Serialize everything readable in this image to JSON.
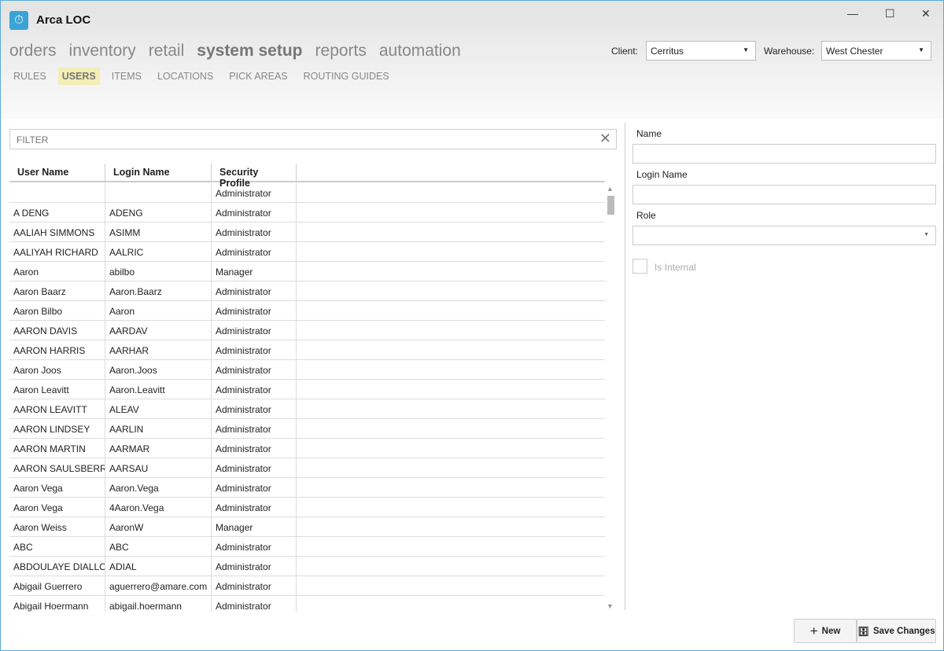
{
  "app": {
    "title": "Arca LOC"
  },
  "nav": {
    "items": [
      "orders",
      "inventory",
      "retail",
      "system setup",
      "reports",
      "automation"
    ],
    "active": 3
  },
  "subnav": {
    "items": [
      "RULES",
      "USERS",
      "ITEMS",
      "LOCATIONS",
      "PICK AREAS",
      "ROUTING GUIDES"
    ],
    "active": 1
  },
  "client": {
    "label": "Client:",
    "value": "Cerritus"
  },
  "warehouse": {
    "label": "Warehouse:",
    "value": "West Chester"
  },
  "filter": {
    "placeholder": "FILTER"
  },
  "table": {
    "columns": [
      "User Name",
      "Login Name",
      "Security Profile"
    ],
    "rows": [
      [
        "",
        "",
        "Administrator"
      ],
      [
        "A DENG",
        "ADENG",
        "Administrator"
      ],
      [
        "AALIAH SIMMONS",
        "ASIMM",
        "Administrator"
      ],
      [
        "AALIYAH RICHARD",
        "AALRIC",
        "Administrator"
      ],
      [
        "Aaron",
        "abilbo",
        "Manager"
      ],
      [
        "Aaron Baarz",
        "Aaron.Baarz",
        "Administrator"
      ],
      [
        "Aaron Bilbo",
        "Aaron",
        "Administrator"
      ],
      [
        "AARON DAVIS",
        "AARDAV",
        "Administrator"
      ],
      [
        "AARON HARRIS",
        "AARHAR",
        "Administrator"
      ],
      [
        "Aaron Joos",
        "Aaron.Joos",
        "Administrator"
      ],
      [
        "Aaron Leavitt",
        "Aaron.Leavitt",
        "Administrator"
      ],
      [
        "AARON LEAVITT",
        "ALEAV",
        "Administrator"
      ],
      [
        "AARON LINDSEY",
        "AARLIN",
        "Administrator"
      ],
      [
        "AARON MARTIN",
        "AARMAR",
        "Administrator"
      ],
      [
        "AARON SAULSBERRY",
        "AARSAU",
        "Administrator"
      ],
      [
        "Aaron Vega",
        "Aaron.Vega",
        "Administrator"
      ],
      [
        "Aaron Vega",
        "4Aaron.Vega",
        "Administrator"
      ],
      [
        "Aaron Weiss",
        "AaronW",
        "Manager"
      ],
      [
        "ABC",
        "ABC",
        "Administrator"
      ],
      [
        "ABDOULAYE DIALLO",
        "ADIAL",
        "Administrator"
      ],
      [
        "Abigail Guerrero",
        "aguerrero@amare.com",
        "Administrator"
      ],
      [
        "Abigail Hoermann",
        "abigail.hoermann",
        "Administrator"
      ]
    ]
  },
  "form": {
    "name_label": "Name",
    "login_label": "Login Name",
    "role_label": "Role",
    "internal_label": "Is Internal"
  },
  "buttons": {
    "new": "New",
    "save": "Save Changes"
  }
}
